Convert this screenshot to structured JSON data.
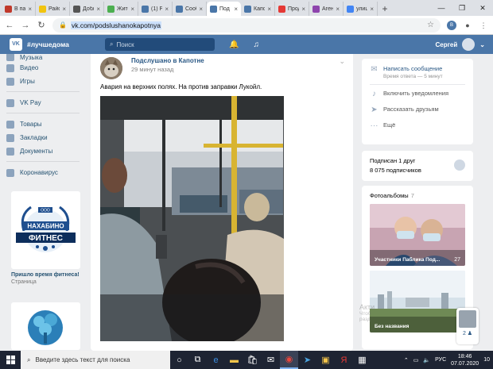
{
  "browser": {
    "tabs": [
      {
        "label": "В пар",
        "color": "#c0392b"
      },
      {
        "label": "Район",
        "color": "#f1c40f"
      },
      {
        "label": "Добл",
        "color": "#555555"
      },
      {
        "label": "Житель",
        "color": "#4caf50"
      },
      {
        "label": "(1) Ра",
        "color": "#4a76a8"
      },
      {
        "label": "Сообщ",
        "color": "#4a76a8"
      },
      {
        "label": "Под",
        "color": "#4a76a8",
        "active": true
      },
      {
        "label": "Капот",
        "color": "#4a76a8"
      },
      {
        "label": "Прод",
        "color": "#e53935"
      },
      {
        "label": "Агент",
        "color": "#8e44ad"
      },
      {
        "label": "улица",
        "color": "#4285f4"
      }
    ],
    "tab_close": "×",
    "new_tab": "+",
    "window_controls": [
      "—",
      "❐",
      "✕"
    ],
    "url": "vk.com/podslushanokapotnya",
    "back": "←",
    "forward": "→",
    "reload": "↻"
  },
  "vk": {
    "logo": "VK",
    "community": "#лучшедома",
    "search_placeholder": "Поиск",
    "user_name": "Сергей",
    "bell_icon": "🔔",
    "music_icon": "♫"
  },
  "sidebar": {
    "items": [
      {
        "label": "Музыка"
      },
      {
        "label": "Видео"
      },
      {
        "label": "Игры"
      },
      {
        "label": "VK Pay"
      },
      {
        "label": "Товары"
      },
      {
        "label": "Закладки"
      },
      {
        "label": "Документы"
      },
      {
        "label": "Коронавирус"
      }
    ],
    "promo1_title": "НАХАБИНО",
    "promo1_subtitle": "ФИТНЕС",
    "promo1_badge": "ООО",
    "promo_caption": "Пришло время фитнеса!",
    "promo_caption_sub": "Страница"
  },
  "post": {
    "author": "Подслушано в Капотне",
    "time": "29 минут назад",
    "text": "Авария на верхних полях. На против заправки Лукойл.",
    "menu": "⌄"
  },
  "right": {
    "write_message": "Написать сообщение",
    "response_time": "Время ответа — 5 минут",
    "enable_notifications": "Включить уведомления",
    "tell_friends": "Рассказать друзьям",
    "more": "Ещё",
    "subscribed_friend": "Подписан 1 друг",
    "subscribers": "8 075 подписчиков",
    "albums_title": "Фотоальбомы",
    "albums_count": "7",
    "albums": [
      {
        "label": "Участники Паблика Под...",
        "count": "27"
      },
      {
        "label": "Без названия",
        "count": "2"
      }
    ]
  },
  "watermark": {
    "line1": "Акти",
    "line2": "Чтоб",
    "line3": "разд"
  },
  "float_count": "2 ♟",
  "taskbar": {
    "search_placeholder": "Введите здесь текст для поиска",
    "lang": "РУС",
    "time": "18:46",
    "date": "07.07.2020",
    "notif": "10"
  }
}
